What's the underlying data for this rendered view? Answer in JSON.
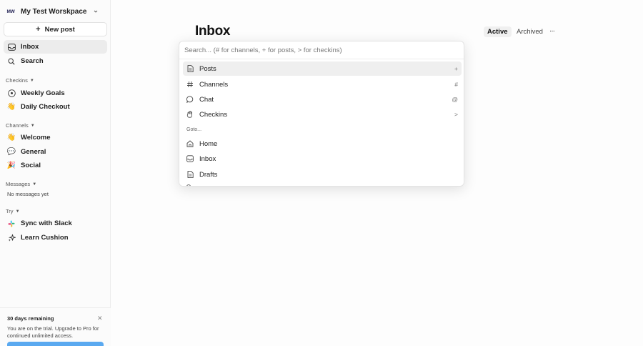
{
  "workspace": {
    "badge": "MW",
    "name": "My Test Worskpace"
  },
  "sidebar": {
    "new_post": "New post",
    "nav": [
      {
        "label": "Inbox",
        "icon": "inbox-icon"
      },
      {
        "label": "Search",
        "icon": "search-icon"
      }
    ],
    "checkins": {
      "title": "Checkins",
      "items": [
        {
          "label": "Weekly Goals",
          "icon": "soccer-ball-icon"
        },
        {
          "label": "Daily Checkout",
          "icon": "waving-hand-icon"
        }
      ]
    },
    "channels": {
      "title": "Channels",
      "items": [
        {
          "label": "Welcome",
          "icon": "waving-hand-icon"
        },
        {
          "label": "General",
          "icon": "speech-balloon-icon"
        },
        {
          "label": "Social",
          "icon": "party-popper-icon"
        }
      ]
    },
    "messages": {
      "title": "Messages",
      "empty": "No messages yet"
    },
    "try": {
      "title": "Try",
      "items": [
        {
          "label": "Sync with Slack",
          "icon": "slack-icon"
        },
        {
          "label": "Learn Cushion",
          "icon": "sparkle-icon"
        }
      ]
    },
    "trial": {
      "title": "30 days remaining",
      "body": "You are on the trial. Upgrade to Pro for continued unlimited access."
    }
  },
  "main": {
    "title": "Inbox",
    "tabs": [
      {
        "label": "Active"
      },
      {
        "label": "Archived"
      }
    ],
    "more": "···"
  },
  "palette": {
    "placeholder": "Search... (# for channels, + for posts, > for checkins)",
    "items": [
      {
        "label": "Posts",
        "shortcut": "+",
        "icon": "document-icon"
      },
      {
        "label": "Channels",
        "shortcut": "#",
        "icon": "hash-icon"
      },
      {
        "label": "Chat",
        "shortcut": "@",
        "icon": "chat-bubble-icon"
      },
      {
        "label": "Checkins",
        "shortcut": ">",
        "icon": "hand-icon"
      }
    ],
    "goto_label": "Goto...",
    "goto": [
      {
        "label": "Home",
        "icon": "home-icon"
      },
      {
        "label": "Inbox",
        "icon": "inbox-icon"
      },
      {
        "label": "Drafts",
        "icon": "document-icon"
      }
    ]
  },
  "colors": {
    "accent": "#5aa9f0",
    "active_bg": "#ececec",
    "border": "#e3e3e3"
  }
}
